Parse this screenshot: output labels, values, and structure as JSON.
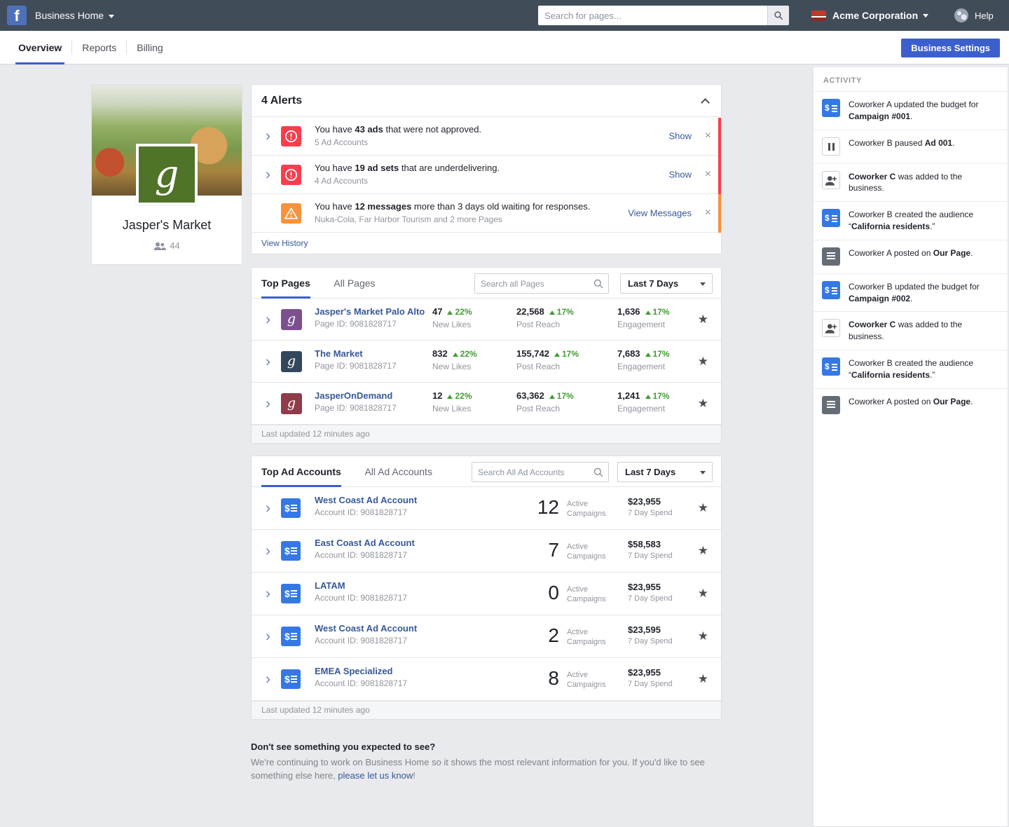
{
  "colors": {
    "accent_blue": "#3b5fcc",
    "link_blue": "#365899",
    "positive_green": "#429b33",
    "alert_red": "#fa3e4e",
    "warning_orange": "#f7923b",
    "ad_icon_blue": "#3578e5",
    "profile_logo_green": "#4f7328",
    "page_icon_colors": [
      "#7c4f8f",
      "#33475c",
      "#8f3b4a"
    ]
  },
  "topbar": {
    "app_title": "Business Home",
    "search_placeholder": "Search for pages...",
    "account_name": "Acme Corporation",
    "help_label": "Help"
  },
  "nav": {
    "tabs": [
      "Overview",
      "Reports",
      "Billing"
    ],
    "settings_button": "Business Settings"
  },
  "profile": {
    "name": "Jasper's Market",
    "members": "44"
  },
  "alerts": {
    "title": "4 Alerts",
    "items": [
      {
        "icon": "error-icon",
        "pre": "You have ",
        "bold": "43 ads",
        "post": " that were not approved.",
        "sub": "5 Ad Accounts",
        "action": "Show"
      },
      {
        "icon": "error-icon",
        "pre": "You have ",
        "bold": "19 ad sets",
        "post": " that are underdelivering.",
        "sub": "4 Ad Accounts",
        "action": "Show"
      },
      {
        "icon": "warning-icon",
        "pre": "You have ",
        "bold": "12 messages",
        "post": " more than 3 days old waiting for responses.",
        "sub": "Nuka-Cola, Far Harbor Tourism and 2 more Pages",
        "action": "View Messages"
      }
    ],
    "view_history": "View History"
  },
  "pages": {
    "tabs": [
      "Top Pages",
      "All Pages"
    ],
    "search_placeholder": "Search all Pages",
    "date_range": "Last 7 Days",
    "rows": [
      {
        "name": "Jasper's Market Palo Alto",
        "id": "Page ID: 9081828717",
        "likes": "47",
        "likes_delta": "22%",
        "likes_label": "New Likes",
        "reach": "22,568",
        "reach_delta": "17%",
        "reach_label": "Post Reach",
        "engagement": "1,636",
        "engagement_delta": "17%",
        "engagement_label": "Engagement"
      },
      {
        "name": "The Market",
        "id": "Page ID: 9081828717",
        "likes": "832",
        "likes_delta": "22%",
        "likes_label": "New Likes",
        "reach": "155,742",
        "reach_delta": "17%",
        "reach_label": "Post Reach",
        "engagement": "7,683",
        "engagement_delta": "17%",
        "engagement_label": "Engagement"
      },
      {
        "name": "JasperOnDemand",
        "id": "Page ID: 9081828717",
        "likes": "12",
        "likes_delta": "22%",
        "likes_label": "New Likes",
        "reach": "63,362",
        "reach_delta": "17%",
        "reach_label": "Post Reach",
        "engagement": "1,241",
        "engagement_delta": "17%",
        "engagement_label": "Engagement"
      }
    ],
    "footer": "Last updated 12 minutes ago"
  },
  "ad_accounts": {
    "tabs": [
      "Top Ad Accounts",
      "All Ad Accounts"
    ],
    "search_placeholder": "Search All Ad Accounts",
    "date_range": "Last 7 Days",
    "rows": [
      {
        "name": "West Coast Ad Account",
        "id": "Account ID: 9081828717",
        "campaigns": "12",
        "campaigns_label": "Active Campaigns",
        "spend": "$23,955",
        "spend_label": "7 Day Spend"
      },
      {
        "name": "East Coast Ad Account",
        "id": "Account ID: 9081828717",
        "campaigns": "7",
        "campaigns_label": "Active Campaigns",
        "spend": "$58,583",
        "spend_label": "7 Day Spend"
      },
      {
        "name": "LATAM",
        "id": "Account ID: 9081828717",
        "campaigns": "0",
        "campaigns_label": "Active Campaigns",
        "spend": "$23,955",
        "spend_label": "7 Day Spend"
      },
      {
        "name": "West Coast Ad Account",
        "id": "Account ID: 9081828717",
        "campaigns": "2",
        "campaigns_label": "Active Campaigns",
        "spend": "$23,595",
        "spend_label": "7 Day Spend"
      },
      {
        "name": "EMEA Specialized",
        "id": "Account ID: 9081828717",
        "campaigns": "8",
        "campaigns_label": "Active Campaigns",
        "spend": "$23,955",
        "spend_label": "7 Day Spend"
      }
    ],
    "footer": "Last updated 12 minutes ago"
  },
  "note": {
    "title": "Don't see something you expected to see?",
    "body": "We're continuing to work on Business Home so it shows the most relevant information for you. If you'd like to see something else here, ",
    "link": "please let us know",
    "post": "!"
  },
  "activity": {
    "title": "ACTIVITY",
    "items": [
      {
        "icon": "ad-account-icon",
        "pre": "Coworker A updated the budget for ",
        "bold": "Campaign #001",
        "post": "."
      },
      {
        "icon": "pause-icon",
        "pre": "Coworker B paused ",
        "bold": "Ad 001",
        "post": "."
      },
      {
        "icon": "person-add-icon",
        "pre": "",
        "bold": "Coworker C",
        "post": " was added to the business."
      },
      {
        "icon": "ad-account-icon",
        "pre": "Coworker B created the audience “",
        "bold": "California residents",
        "post": ".”"
      },
      {
        "icon": "page-post-icon",
        "pre": "Coworker A posted on ",
        "bold": "Our Page",
        "post": "."
      },
      {
        "icon": "ad-account-icon",
        "pre": "Coworker B updated the budget for ",
        "bold": "Campaign #002",
        "post": "."
      },
      {
        "icon": "person-add-icon",
        "pre": "",
        "bold": "Coworker C",
        "post": " was added to the business."
      },
      {
        "icon": "ad-account-icon",
        "pre": "Coworker B created the audience “",
        "bold": "California residents",
        "post": ".”"
      },
      {
        "icon": "page-post-icon",
        "pre": "Coworker A posted on ",
        "bold": "Our Page",
        "post": "."
      }
    ]
  }
}
